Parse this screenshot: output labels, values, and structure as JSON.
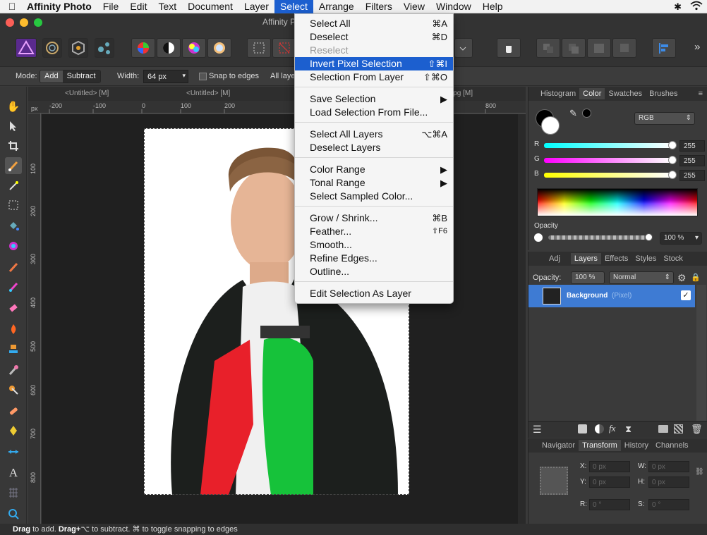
{
  "menubar": {
    "app": "Affinity Photo",
    "items": [
      "File",
      "Edit",
      "Text",
      "Document",
      "Layer",
      "Select",
      "Arrange",
      "Filters",
      "View",
      "Window",
      "Help"
    ],
    "active": "Select"
  },
  "window": {
    "title": "Affinity P"
  },
  "context": {
    "mode_label": "Mode:",
    "mode_add": "Add",
    "mode_subtract": "Subtract",
    "width_label": "Width:",
    "width_value": "64 px",
    "snap_label": "Snap to edges",
    "all_layers": "All laye"
  },
  "doc_tabs": [
    "<Untitled> [M]",
    "<Untitled> [M]",
    "jpg [M]"
  ],
  "ruler": {
    "unit": "px",
    "h_ticks": [
      "-200",
      "-100",
      "0",
      "100",
      "200",
      "800"
    ],
    "v_ticks": [
      "100",
      "200",
      "300",
      "400",
      "500",
      "600",
      "700",
      "800"
    ]
  },
  "status": {
    "drag": "Drag",
    "text1": " to add. ",
    "drag2": "Drag+",
    "text2": "⌥ to subtract. ",
    "text3": "⌘ to toggle snapping to edges"
  },
  "color_panel": {
    "tabs": [
      "Histogram",
      "Color",
      "Swatches",
      "Brushes"
    ],
    "active_tab": "Color",
    "model": "RGB",
    "channels": [
      {
        "name": "R",
        "value": "255"
      },
      {
        "name": "G",
        "value": "255"
      },
      {
        "name": "B",
        "value": "255"
      }
    ],
    "opacity_label": "Opacity",
    "opacity_value": "100 %"
  },
  "layers_panel": {
    "tabs": [
      "Adj",
      "Layers",
      "Effects",
      "Styles",
      "Stock"
    ],
    "active_tab": "Layers",
    "opacity_label": "Opacity:",
    "opacity_value": "100 %",
    "blend_mode": "Normal",
    "layer_name": "Background",
    "layer_type": "(Pixel)"
  },
  "transform_panel": {
    "tabs": [
      "Navigator",
      "Transform",
      "History",
      "Channels"
    ],
    "active_tab": "Transform",
    "x_label": "X:",
    "x_value": "0 px",
    "y_label": "Y:",
    "y_value": "0 px",
    "w_label": "W:",
    "w_value": "0 px",
    "h_label": "H:",
    "h_value": "0 px",
    "r_label": "R:",
    "r_value": "0 °",
    "s_label": "S:",
    "s_value": "0 °"
  },
  "select_menu": {
    "items": [
      {
        "label": "Select All",
        "shortcut": "⌘A"
      },
      {
        "label": "Deselect",
        "shortcut": "⌘D"
      },
      {
        "label": "Reselect",
        "shortcut": "",
        "disabled": true
      },
      {
        "label": "Invert Pixel Selection",
        "shortcut": "⇧⌘I",
        "highlight": true
      },
      {
        "label": "Selection From Layer",
        "shortcut": "⇧⌘O"
      },
      {
        "label": "Save Selection",
        "shortcut": "▶"
      },
      {
        "label": "Load Selection From File...",
        "shortcut": ""
      },
      {
        "label": "Select All Layers",
        "shortcut": "⌥⌘A"
      },
      {
        "label": "Deselect Layers",
        "shortcut": ""
      },
      {
        "label": "Color Range",
        "shortcut": "▶"
      },
      {
        "label": "Tonal Range",
        "shortcut": "▶"
      },
      {
        "label": "Select Sampled Color...",
        "shortcut": ""
      },
      {
        "label": "Grow / Shrink...",
        "shortcut": "⌘B"
      },
      {
        "label": "Feather...",
        "shortcut": "⇧F6"
      },
      {
        "label": "Smooth...",
        "shortcut": ""
      },
      {
        "label": "Refine Edges...",
        "shortcut": ""
      },
      {
        "label": "Outline...",
        "shortcut": ""
      },
      {
        "label": "Edit Selection As Layer",
        "shortcut": ""
      }
    ]
  }
}
